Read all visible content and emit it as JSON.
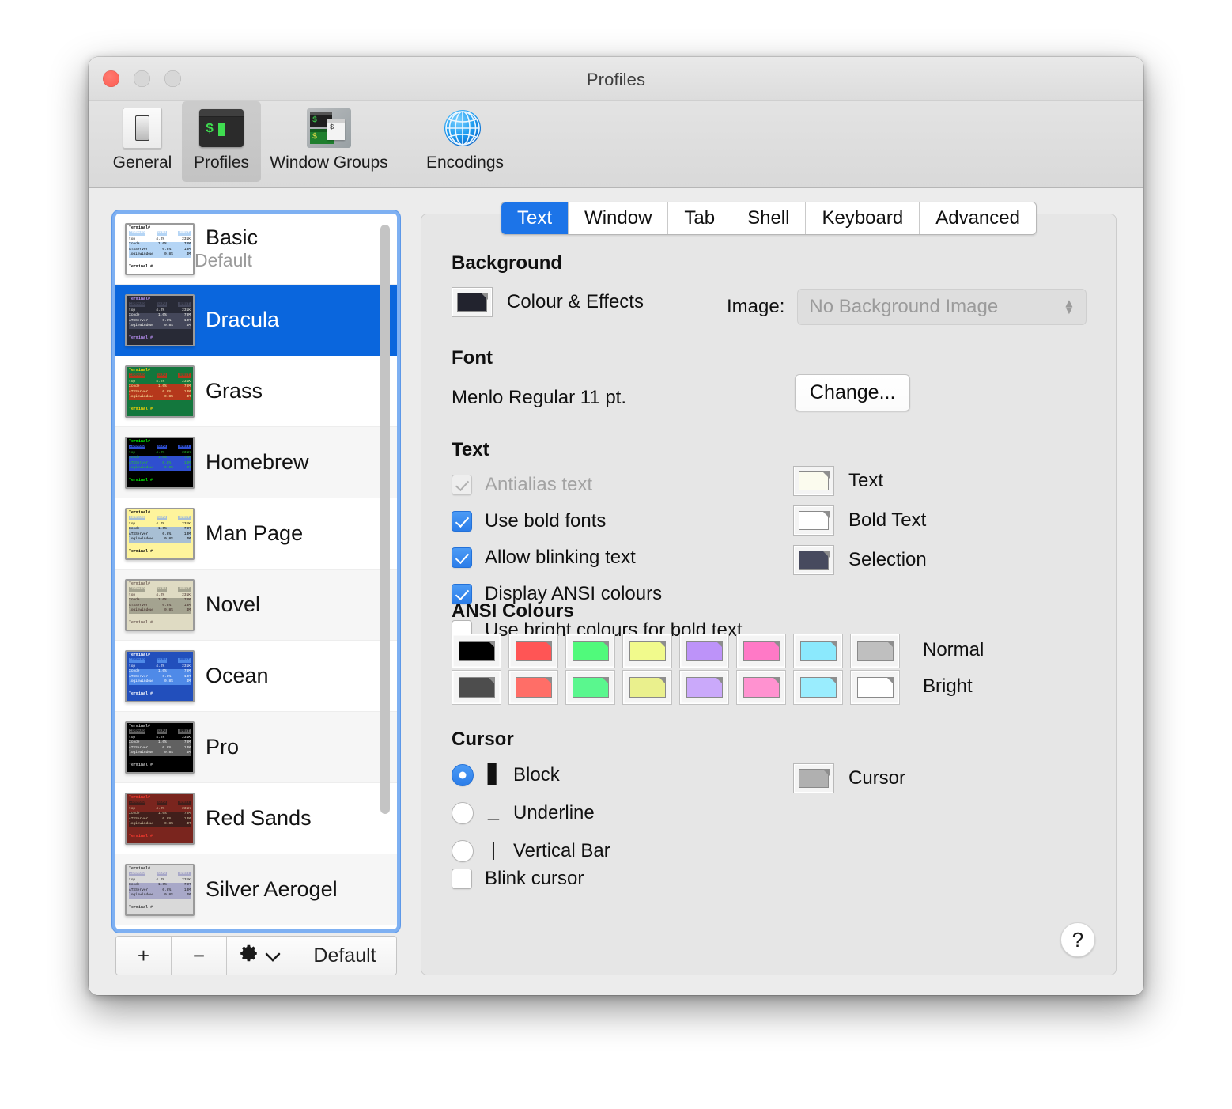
{
  "window": {
    "title": "Profiles",
    "traffic_lights": [
      "close",
      "minimise",
      "zoom"
    ]
  },
  "toolbar": {
    "items": [
      {
        "label": "General",
        "icon": "light-switch-icon",
        "selected": false
      },
      {
        "label": "Profiles",
        "icon": "terminal-icon",
        "selected": true
      },
      {
        "label": "Window Groups",
        "icon": "window-groups-icon",
        "selected": false
      },
      {
        "label": "Encodings",
        "icon": "globe-icon",
        "selected": false
      }
    ]
  },
  "profile_list": {
    "profiles": [
      {
        "name": "Basic",
        "subtitle": "Default",
        "selected": false,
        "theme": {
          "bg": "#ffffff",
          "fg": "#000000",
          "sel": "#b5d5f5",
          "accent": "#000000"
        }
      },
      {
        "name": "Dracula",
        "subtitle": "",
        "selected": true,
        "theme": {
          "bg": "#282a36",
          "fg": "#f8f8f2",
          "sel": "#44475a",
          "accent": "#bd93f9"
        }
      },
      {
        "name": "Grass",
        "subtitle": "",
        "selected": false,
        "theme": {
          "bg": "#13773d",
          "fg": "#fff0a5",
          "sel": "#b5381c",
          "accent": "#ffd700"
        }
      },
      {
        "name": "Homebrew",
        "subtitle": "",
        "selected": false,
        "theme": {
          "bg": "#000000",
          "fg": "#28c328",
          "sel": "#2f4fcf",
          "accent": "#00ff00"
        }
      },
      {
        "name": "Man Page",
        "subtitle": "",
        "selected": false,
        "theme": {
          "bg": "#fef49c",
          "fg": "#000000",
          "sel": "#a8bfd4",
          "accent": "#000000"
        }
      },
      {
        "name": "Novel",
        "subtitle": "",
        "selected": false,
        "theme": {
          "bg": "#dfdbc3",
          "fg": "#3b2322",
          "sel": "#a4a390",
          "accent": "#73635a"
        }
      },
      {
        "name": "Ocean",
        "subtitle": "",
        "selected": false,
        "theme": {
          "bg": "#224fbc",
          "fg": "#ffffff",
          "sel": "#4f8ae8",
          "accent": "#ffffff"
        }
      },
      {
        "name": "Pro",
        "subtitle": "",
        "selected": false,
        "theme": {
          "bg": "#000000",
          "fg": "#f2f2f2",
          "sel": "#616161",
          "accent": "#bdbdbd"
        }
      },
      {
        "name": "Red Sands",
        "subtitle": "",
        "selected": false,
        "theme": {
          "bg": "#7a251e",
          "fg": "#d7c9a7",
          "sel": "#411f1b",
          "accent": "#ff3b30"
        }
      },
      {
        "name": "Silver Aerogel",
        "subtitle": "",
        "selected": false,
        "theme": {
          "bg": "#d9d9d9",
          "fg": "#1a1a1a",
          "sel": "#a8a8c8",
          "accent": "#3a3a3a"
        }
      }
    ],
    "thumbnail_text": {
      "title": "Terminal#",
      "columns": [
        "COMMAND",
        "%CPU",
        "RPRVT"
      ],
      "rows": [
        {
          "command": "top",
          "cpu": "4.2%",
          "rprvt": "231K"
        },
        {
          "command": "Xcode",
          "cpu": "1.6%",
          "rprvt": "78M"
        },
        {
          "command": "ATSServer",
          "cpu": "0.8%",
          "rprvt": "13M"
        },
        {
          "command": "loginwindow",
          "cpu": "0.8%",
          "rprvt": "4M"
        }
      ],
      "prompt": "Terminal #"
    },
    "buttons": {
      "add": "+",
      "remove": "−",
      "gear": "gear",
      "default": "Default"
    }
  },
  "panel": {
    "tabs": [
      {
        "label": "Text",
        "active": true
      },
      {
        "label": "Window",
        "active": false
      },
      {
        "label": "Tab",
        "active": false
      },
      {
        "label": "Shell",
        "active": false
      },
      {
        "label": "Keyboard",
        "active": false
      },
      {
        "label": "Advanced",
        "active": false
      }
    ],
    "background": {
      "heading": "Background",
      "colour_effects_label": "Colour & Effects",
      "colour_swatch": "#22232e",
      "image_label": "Image:",
      "image_value": "No Background Image"
    },
    "font": {
      "heading": "Font",
      "value": "Menlo Regular 11 pt.",
      "change_button": "Change..."
    },
    "text": {
      "heading": "Text",
      "checkboxes": [
        {
          "label": "Antialias text",
          "checked": true,
          "enabled": false
        },
        {
          "label": "Use bold fonts",
          "checked": true,
          "enabled": true
        },
        {
          "label": "Allow blinking text",
          "checked": true,
          "enabled": true
        },
        {
          "label": "Display ANSI colours",
          "checked": true,
          "enabled": true
        },
        {
          "label": "Use bright colours for bold text",
          "checked": false,
          "enabled": true
        }
      ],
      "colour_wells": [
        {
          "label": "Text",
          "colour": "#fbfbee"
        },
        {
          "label": "Bold Text",
          "colour": "#ffffff"
        },
        {
          "label": "Selection",
          "colour": "#474a5e"
        }
      ]
    },
    "ansi": {
      "heading": "ANSI Colours",
      "normal_label": "Normal",
      "bright_label": "Bright",
      "normal": [
        "#000000",
        "#ff5555",
        "#50fa7b",
        "#f1fa8c",
        "#bd93f9",
        "#ff79c6",
        "#8be9fd",
        "#bfbfbf"
      ],
      "bright": [
        "#4d4d4d",
        "#ff6e67",
        "#5af78e",
        "#eaf08d",
        "#caa9fa",
        "#ff92d0",
        "#9aedfe",
        "#ffffff"
      ]
    },
    "cursor": {
      "heading": "Cursor",
      "options": [
        {
          "label": "Block",
          "glyph": "▊",
          "selected": true
        },
        {
          "label": "Underline",
          "glyph": "_",
          "selected": false
        },
        {
          "label": "Vertical Bar",
          "glyph": "|",
          "selected": false
        }
      ],
      "blink": {
        "label": "Blink cursor",
        "checked": false
      },
      "colour_well": {
        "label": "Cursor",
        "colour": "#b0b0b0"
      }
    },
    "help_button": "?"
  }
}
